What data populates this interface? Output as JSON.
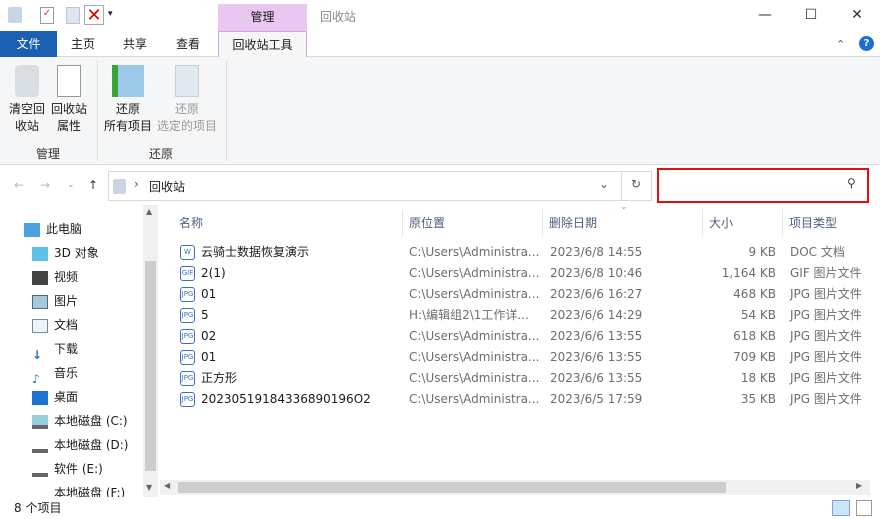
{
  "titlebar": {
    "context_tab": "管理",
    "window_title": "回收站",
    "minimize": "—",
    "maximize": "☐",
    "close": "✕"
  },
  "tabs": [
    "文件",
    "主页",
    "共享",
    "查看",
    "回收站工具"
  ],
  "ribbon": {
    "buttons": [
      {
        "label1": "清空回",
        "label2": "收站"
      },
      {
        "label1": "回收站",
        "label2": "属性"
      },
      {
        "label1": "还原",
        "label2": "所有项目"
      },
      {
        "label1": "还原",
        "label2": "选定的项目"
      }
    ],
    "groups": [
      "管理",
      "还原"
    ]
  },
  "address": {
    "path": "回收站",
    "search_placeholder": ""
  },
  "nav": [
    "此电脑",
    "3D 对象",
    "视频",
    "图片",
    "文档",
    "下载",
    "音乐",
    "桌面",
    "本地磁盘 (C:)",
    "本地磁盘 (D:)",
    "软件 (E:)",
    "本地磁盘 (F:)"
  ],
  "columns": [
    "名称",
    "原位置",
    "删除日期",
    "大小",
    "项目类型"
  ],
  "files": [
    {
      "name": "云骑士数据恢复演示",
      "icon": "doc",
      "loc": "C:\\Users\\Administra...",
      "date": "2023/6/8 14:55",
      "size": "9 KB",
      "type": "DOC 文档"
    },
    {
      "name": "2(1)",
      "icon": "gif",
      "loc": "C:\\Users\\Administra...",
      "date": "2023/6/8 10:46",
      "size": "1,164 KB",
      "type": "GIF 图片文件"
    },
    {
      "name": "01",
      "icon": "jpg",
      "loc": "C:\\Users\\Administra...",
      "date": "2023/6/6 16:27",
      "size": "468 KB",
      "type": "JPG 图片文件"
    },
    {
      "name": "5",
      "icon": "jpg",
      "loc": "H:\\编辑组2\\1工作详...",
      "date": "2023/6/6 14:29",
      "size": "54 KB",
      "type": "JPG 图片文件"
    },
    {
      "name": "02",
      "icon": "jpg",
      "loc": "C:\\Users\\Administra...",
      "date": "2023/6/6 13:55",
      "size": "618 KB",
      "type": "JPG 图片文件"
    },
    {
      "name": "01",
      "icon": "jpg",
      "loc": "C:\\Users\\Administra...",
      "date": "2023/6/6 13:55",
      "size": "709 KB",
      "type": "JPG 图片文件"
    },
    {
      "name": "正方形",
      "icon": "jpg",
      "loc": "C:\\Users\\Administra...",
      "date": "2023/6/6 13:55",
      "size": "18 KB",
      "type": "JPG 图片文件"
    },
    {
      "name": "20230519184336890196O2",
      "icon": "jpg",
      "loc": "C:\\Users\\Administra...",
      "date": "2023/6/5 17:59",
      "size": "35 KB",
      "type": "JPG 图片文件"
    }
  ],
  "status": "8 个项目"
}
